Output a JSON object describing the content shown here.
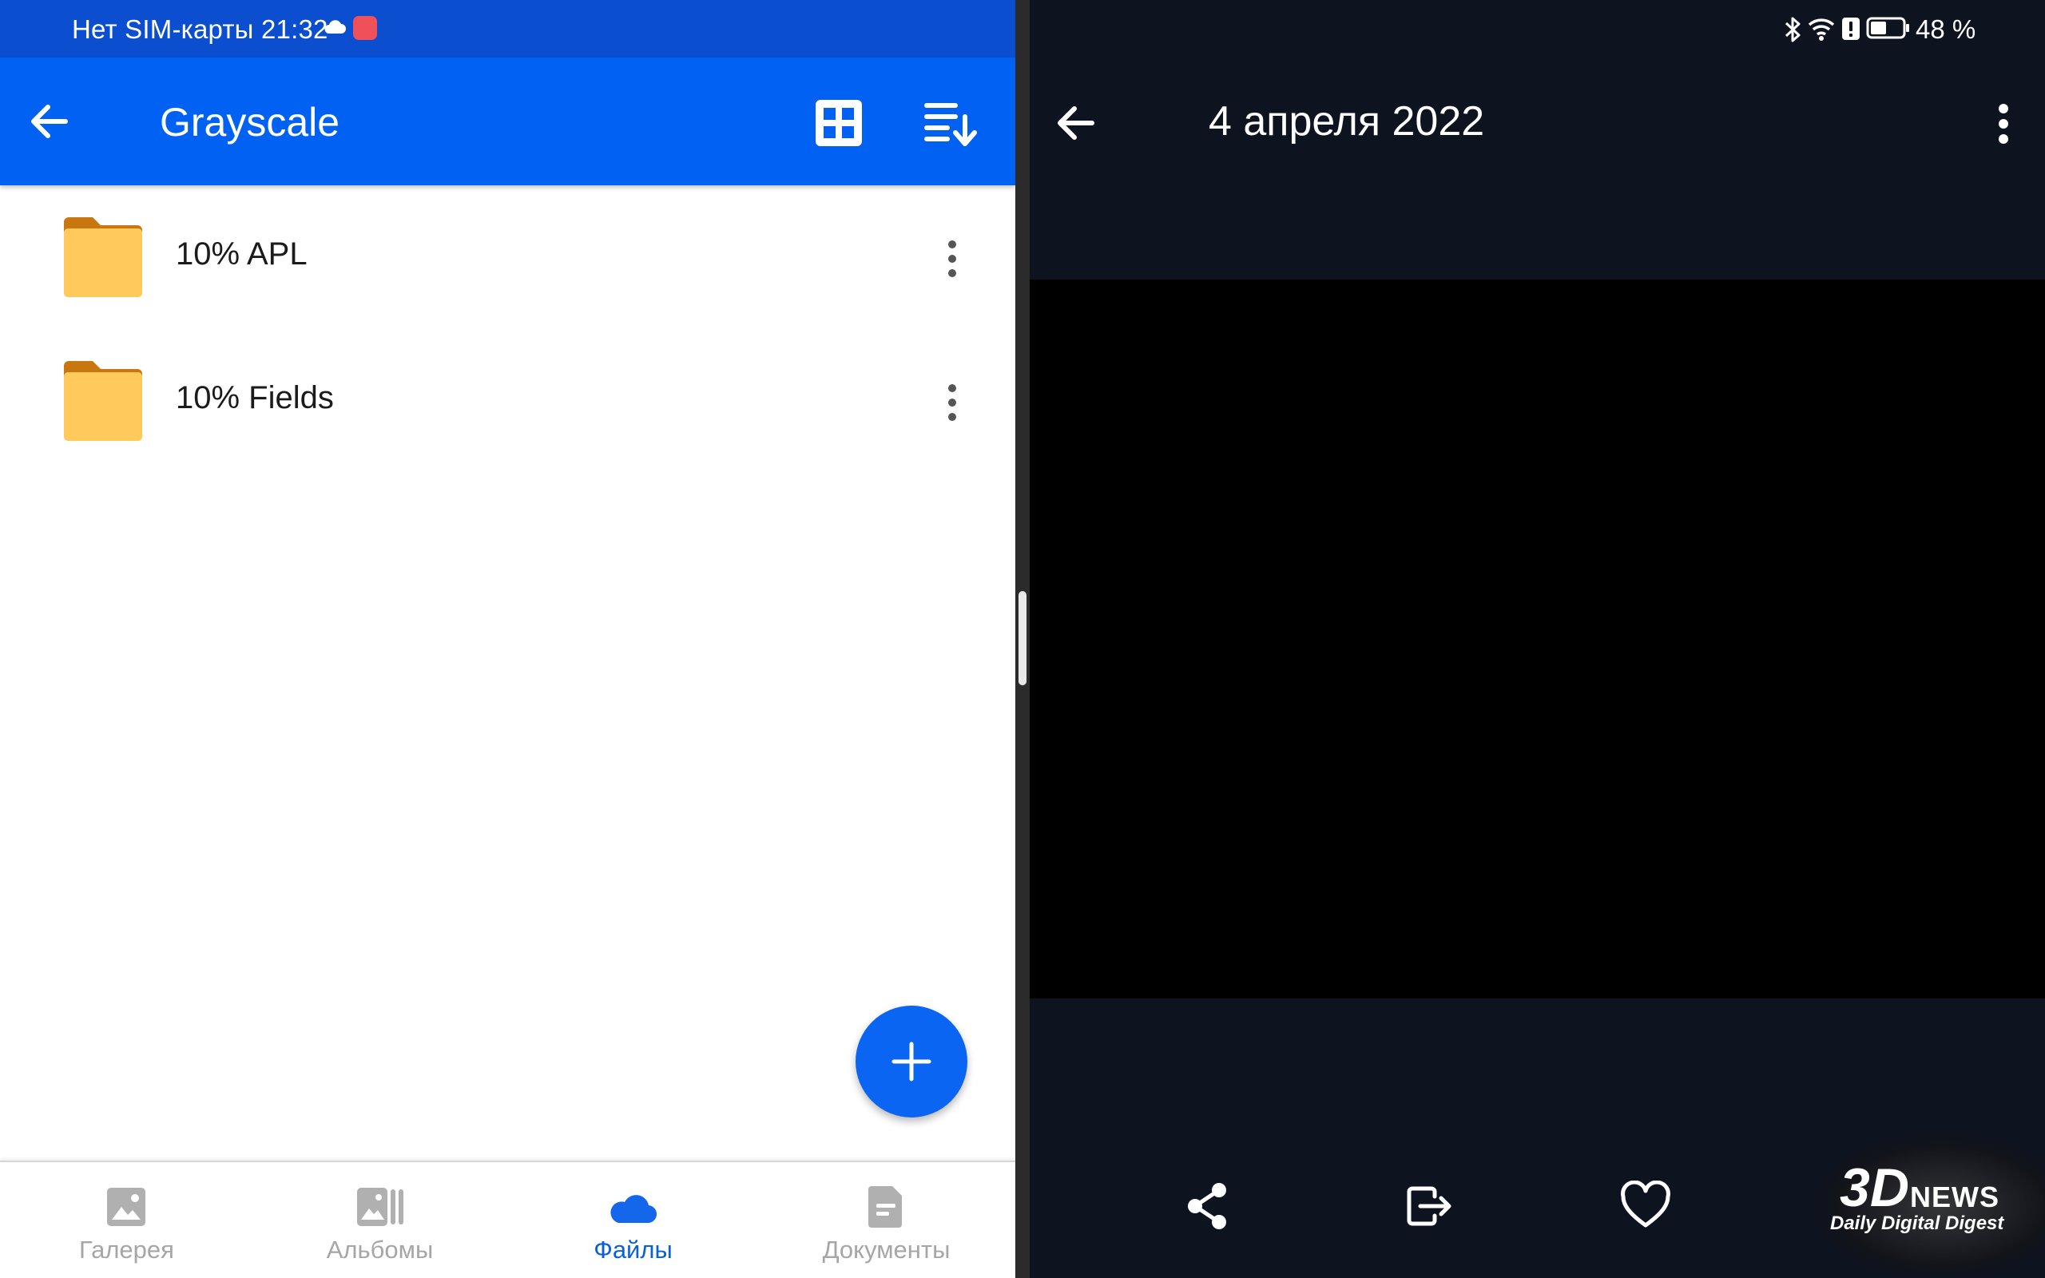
{
  "left": {
    "status_bar": {
      "text": "Нет SIM-карты 21:32"
    },
    "app_bar": {
      "title": "Grayscale"
    },
    "folders": [
      {
        "name": "10% APL"
      },
      {
        "name": "10% Fields"
      }
    ],
    "bottom_nav": [
      {
        "label": "Галерея",
        "icon": "gallery-icon",
        "active": false
      },
      {
        "label": "Альбомы",
        "icon": "albums-icon",
        "active": false
      },
      {
        "label": "Файлы",
        "icon": "cloud-icon",
        "active": true
      },
      {
        "label": "Документы",
        "icon": "document-icon",
        "active": false
      }
    ]
  },
  "right": {
    "status_bar": {
      "battery_percent": "48 %"
    },
    "app_bar": {
      "title": "4 апреля 2022"
    },
    "actions": [
      "share-icon",
      "open-with-icon",
      "favorite-icon"
    ],
    "watermark": {
      "logo": "3D",
      "brand": "NEWS",
      "tagline": "Daily Digital Digest"
    }
  },
  "colors": {
    "primary": "#0061f2",
    "status_bar": "#0b4fd0",
    "folder": "#ffc95c",
    "folder_tab": "#c8760e",
    "viewer_bg": "#0e1320",
    "inactive_nav": "#a6a6a6",
    "active_nav": "#0a5fdf"
  }
}
